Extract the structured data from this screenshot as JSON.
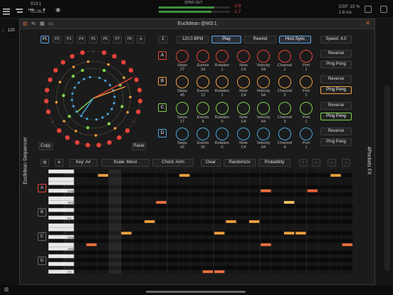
{
  "host": {
    "tempo": "120",
    "time_bars": "813:1",
    "time_secs": "00:26.1",
    "meter_label": "SPKR OUT",
    "meter_left": "-0.9",
    "meter_right": "-1.7",
    "dsp": "DSP: 15 %",
    "latency": "1.6 ms"
  },
  "window": {
    "title": "Euclidean @M3:1"
  },
  "side": {
    "left_label": "Euclidean Sequencer",
    "right_label": "4Pockets FX"
  },
  "patterns": [
    "P1",
    "P2",
    "P3",
    "P4",
    "P5",
    "P6",
    "P7",
    "P8"
  ],
  "transport": {
    "sigma": "Σ",
    "bpm": "120.0 BPM",
    "play": "Play",
    "rewind": "Rewind",
    "hostsync": "Host Sync",
    "speed": "Speed: 4.0"
  },
  "copy_label": "Copy",
  "paste_label": "Paste",
  "tracks": [
    {
      "id": "A",
      "color": "#e8453a",
      "steps": "27",
      "events": "24",
      "rotation": "1",
      "note": "C4",
      "velocity": "64",
      "channel": "1",
      "port": "1",
      "reverse": "Reverse",
      "pingpong": "Ping Pong",
      "pp_active": false
    },
    {
      "id": "B",
      "color": "#f0a040",
      "steps": "45",
      "events": "12",
      "rotation": "1",
      "note": "C4",
      "velocity": "64",
      "channel": "2",
      "port": "1",
      "reverse": "Reverse",
      "pingpong": "Ping Pong",
      "pp_active": true
    },
    {
      "id": "C",
      "color": "#7fd34a",
      "steps": "17",
      "events": "9",
      "rotation": "0",
      "note": "C4",
      "velocity": "64",
      "channel": "3",
      "port": "1",
      "reverse": "Reverse",
      "pingpong": "Ping Pong",
      "pp_active": true
    },
    {
      "id": "D",
      "color": "#4aa8e0",
      "steps": "42",
      "events": "20",
      "rotation": "0",
      "note": "C4",
      "velocity": "64",
      "channel": "4",
      "port": "1",
      "reverse": "Reverse",
      "pingpong": "Ping Pong",
      "pp_active": false
    }
  ],
  "param_labels": [
    "Steps",
    "Events",
    "Rotation",
    "Note",
    "Velocity",
    "Channel",
    "Port"
  ],
  "rollbar": {
    "key": "Key: A#",
    "scale": "Scale: Minor",
    "chord": "Chord: A#m",
    "clear": "Clear",
    "randomize": "Randomize",
    "probability": "Probability"
  },
  "piano_labels": [
    "F5",
    "C#5",
    "A#4",
    "F4",
    "C#4",
    "A#3",
    "F3"
  ],
  "lanes": [
    "A",
    "B",
    "C",
    "D"
  ]
}
